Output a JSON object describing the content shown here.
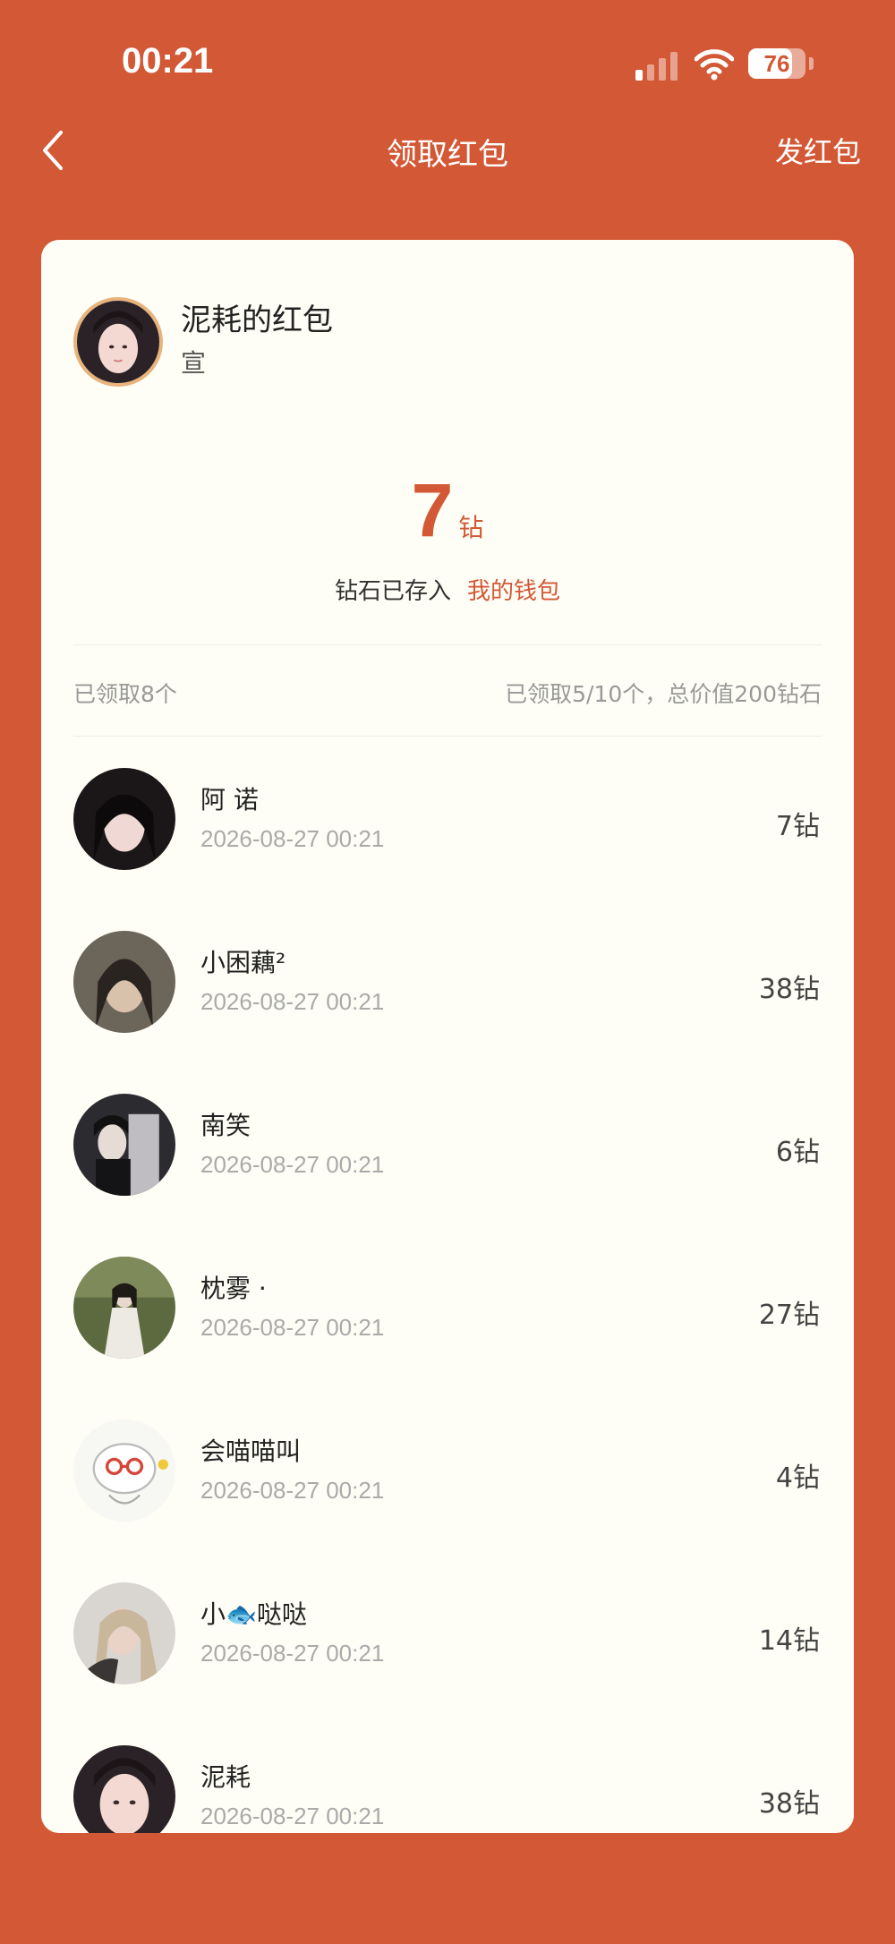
{
  "status_bar": {
    "time": "00:21",
    "battery_level": "76",
    "battery_fraction": 0.76,
    "signal_bars_active": 1,
    "icons": [
      "cellular-signal-icon",
      "wifi-icon",
      "battery-icon"
    ]
  },
  "nav": {
    "back_icon": "chevron-left-icon",
    "title": "领取红包",
    "right_action": "发红包"
  },
  "packet": {
    "sender_title": "泥耗的红包",
    "sender_subtitle": "宣",
    "amount": "7",
    "unit": "钻",
    "stored_text": "钻石已存入",
    "wallet_link": "我的钱包"
  },
  "summary": {
    "left": "已领取8个",
    "right": "已领取5/10个，总价值200钻石"
  },
  "recipients": [
    {
      "name": "阿 诺",
      "time": "2026-08-27 00:21",
      "amount": "7钻"
    },
    {
      "name": "小困藕²",
      "time": "2026-08-27 00:21",
      "amount": "38钻"
    },
    {
      "name": "南笑",
      "time": "2026-08-27 00:21",
      "amount": "6钻"
    },
    {
      "name": "枕雾 ·",
      "time": "2026-08-27 00:21",
      "amount": "27钻"
    },
    {
      "name": "会喵喵叫",
      "time": "2026-08-27 00:21",
      "amount": "4钻"
    },
    {
      "name": "小🐟哒哒",
      "time": "2026-08-27 00:21",
      "amount": "14钻"
    },
    {
      "name": "泥耗",
      "time": "2026-08-27 00:21",
      "amount": "38钻"
    }
  ],
  "colors": {
    "background": "#D35835",
    "card": "#FEFEF6",
    "accent": "#D35835",
    "muted_text": "#999999"
  }
}
